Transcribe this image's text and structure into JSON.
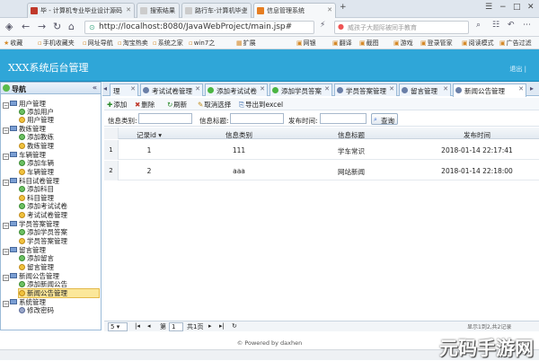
{
  "browser": {
    "tabs": [
      {
        "label": "毕 - 计算机专业毕业设计源码"
      },
      {
        "label": "搜索结果"
      },
      {
        "label": "路行车-计算机毕业"
      },
      {
        "label": "信息管理系统"
      }
    ],
    "url": "http://localhost:8080/JavaWebProject/main.jsp#",
    "search_placeholder": "威孩子大题际被同手教育",
    "bookmarks": [
      "收藏",
      "手机收藏夹",
      "网址导航",
      "淘宝热卖",
      "系统之家",
      "win7之",
      "扩展",
      "网银",
      "翻译",
      "截图",
      "游戏",
      "登录管家",
      "阅读模式",
      "广告过滤"
    ]
  },
  "app": {
    "title": "XXX系统后台管理",
    "user_info": "退出 | "
  },
  "nav": {
    "title": "导航",
    "tree": [
      {
        "label": "用户管理",
        "children": [
          "添加用户",
          "用户管理"
        ]
      },
      {
        "label": "教练管理",
        "children": [
          "添加教练",
          "教练管理"
        ]
      },
      {
        "label": "车辆管理",
        "children": [
          "添加车辆",
          "车辆管理"
        ]
      },
      {
        "label": "科目试卷管理",
        "children": [
          "添加科目",
          "科目管理",
          "添加考试试卷",
          "考试试卷管理"
        ]
      },
      {
        "label": "学员答案管理",
        "children": [
          "添加学员答案",
          "学员答案管理"
        ]
      },
      {
        "label": "留言管理",
        "children": [
          "添加留言",
          "留言管理"
        ]
      },
      {
        "label": "新闻公告管理",
        "children": [
          "添加新闻公告",
          "新闻公告管理"
        ]
      },
      {
        "label": "系统管理",
        "children": [
          "修改密码"
        ]
      }
    ],
    "selected": "新闻公告管理"
  },
  "content_tabs": [
    "理",
    "考试试卷管理",
    "添加考试试卷",
    "添加学员答案",
    "学员答案管理",
    "留言管理",
    "新闻公告管理"
  ],
  "toolbar": {
    "add": "添加",
    "delete": "删除",
    "refresh": "刷新",
    "deselect": "取消选择",
    "export": "导出到excel"
  },
  "filters": {
    "category_label": "信息类别:",
    "title_label": "信息标题:",
    "time_label": "发布时间:",
    "query_button": "查询"
  },
  "grid": {
    "columns": [
      "记录id",
      "信息类别",
      "信息标题",
      "发布时间"
    ],
    "rows": [
      {
        "num": "1",
        "id": "1",
        "category": "111",
        "title": "学车常识",
        "time": "2018-01-14 22:17:41"
      },
      {
        "num": "2",
        "id": "2",
        "category": "aaa",
        "title": "网站新闻",
        "time": "2018-01-14 22:18:00"
      }
    ]
  },
  "pager": {
    "page_size": "5",
    "page_label": "第",
    "page_value": "1",
    "page_total": "共1页",
    "summary": "显示1到2,共2记录"
  },
  "footer": {
    "text": "© Powered by daxhen"
  },
  "watermark": {
    "text": "元码手游网"
  }
}
